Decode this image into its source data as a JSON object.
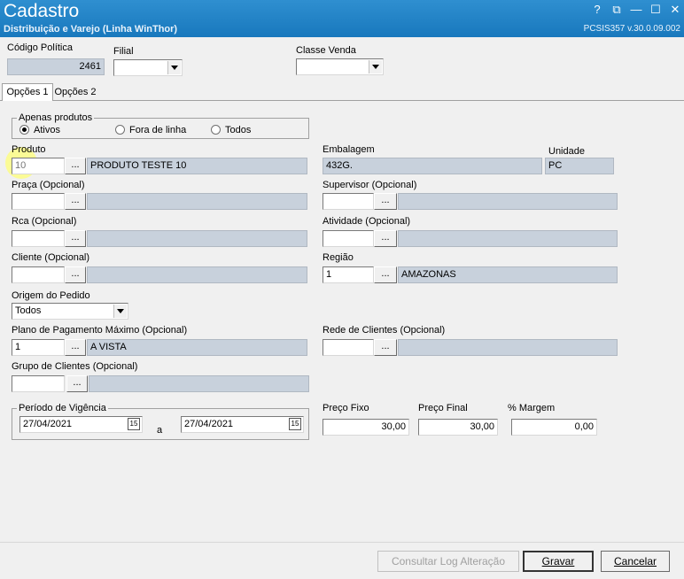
{
  "window": {
    "title": "Cadastro",
    "subtitle": "Distribuição e Varejo (Linha WinThor)",
    "version": "PCSIS357  v.30.0.09.002",
    "help": "?",
    "restore": "⧉",
    "minimize": "—",
    "maximize": "☐",
    "close": "✕"
  },
  "header": {
    "codigo_label": "Código Política",
    "codigo_value": "2461",
    "filial_label": "Filial",
    "filial_value": "",
    "classe_label": "Classe Venda",
    "classe_value": ""
  },
  "tabs": [
    "Opções 1",
    "Opções 2"
  ],
  "apenas": {
    "title": "Apenas produtos",
    "options": [
      "Ativos",
      "Fora de linha",
      "Todos"
    ],
    "selected": "Ativos"
  },
  "form": {
    "produto_label": "Produto",
    "produto_code": "10",
    "produto_desc": "PRODUTO TESTE 10",
    "embalagem_label": "Embalagem",
    "embalagem_value": "432G.",
    "unidade_label": "Unidade",
    "unidade_value": "PC",
    "praca_label": "Praça (Opcional)",
    "supervisor_label": "Supervisor (Opcional)",
    "rca_label": "Rca (Opcional)",
    "atividade_label": "Atividade (Opcional)",
    "cliente_label": "Cliente (Opcional)",
    "regiao_label": "Região",
    "regiao_code": "1",
    "regiao_desc": "AMAZONAS",
    "origem_label": "Origem do Pedido",
    "origem_value": "Todos",
    "plano_label": "Plano de Pagamento Máximo (Opcional)",
    "plano_code": "1",
    "plano_desc": "A VISTA",
    "rede_label": "Rede de Clientes (Opcional)",
    "grupo_label": "Grupo de Clientes (Opcional)",
    "ellipsis": "..."
  },
  "vigencia": {
    "title": "Período de Vigência",
    "start": "27/04/2021",
    "separator": "a",
    "end": "27/04/2021",
    "cal_icon": "15"
  },
  "precos": {
    "fixo_label": "Preço Fixo",
    "fixo_value": "30,00",
    "final_label": "Preço Final",
    "final_value": "30,00",
    "margem_label": "% Margem",
    "margem_value": "0,00"
  },
  "buttons": {
    "log": "Consultar Log Alteração",
    "save": "Gravar",
    "cancel": "Cancelar"
  }
}
